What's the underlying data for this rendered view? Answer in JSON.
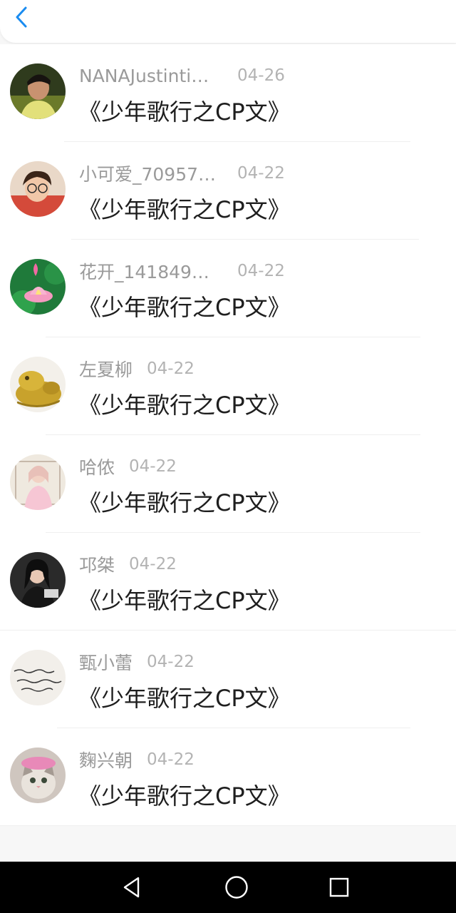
{
  "header": {
    "back_icon": "chevron-left-icon",
    "accent": "#1a8cf0"
  },
  "entries": [
    {
      "name": "NANAJustinti…",
      "date": "04-26",
      "title": "《少年歌行之CP文》",
      "avatar": "user-photo"
    },
    {
      "name": "小可爱_70957…",
      "date": "04-22",
      "title": "《少年歌行之CP文》",
      "avatar": "user-photo"
    },
    {
      "name": "花开_141849…",
      "date": "04-22",
      "title": "《少年歌行之CP文》",
      "avatar": "lotus-photo"
    },
    {
      "name": "左夏柳",
      "date": "04-22",
      "title": "《少年歌行之CP文》",
      "avatar": "golden-toad-photo"
    },
    {
      "name": "哈侬",
      "date": "04-22",
      "title": "《少年歌行之CP文》",
      "avatar": "user-photo"
    },
    {
      "name": "邛桀",
      "date": "04-22",
      "title": "《少年歌行之CP文》",
      "avatar": "user-photo"
    },
    {
      "name": "甄小蕾",
      "date": "04-22",
      "title": "《少年歌行之CP文》",
      "avatar": "handwriting-photo"
    },
    {
      "name": "麴兴朝",
      "date": "04-22",
      "title": "《少年歌行之CP文》",
      "avatar": "cat-photo"
    }
  ],
  "system_nav": {
    "back": "triangle-back-icon",
    "home": "circle-home-icon",
    "recents": "square-recents-icon"
  }
}
